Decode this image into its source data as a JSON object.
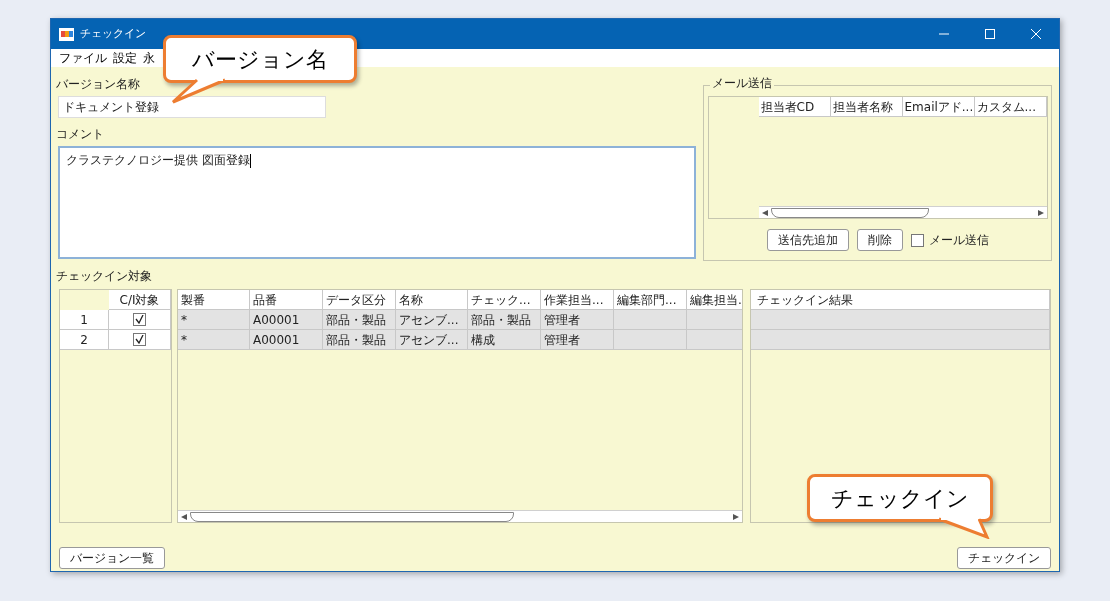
{
  "window": {
    "title": "チェックイン"
  },
  "menu": [
    "ファイル",
    "設定",
    "永"
  ],
  "version_name": {
    "label": "バージョン名称",
    "value": "ドキュメント登録"
  },
  "comment": {
    "label": "コメント",
    "value": "クラステクノロジー提供 図面登録"
  },
  "mail": {
    "legend": "メール送信",
    "columns": [
      "担当者CD",
      "担当者名称",
      "Emailアド...",
      "カスタム..."
    ],
    "buttons": [
      "送信先追加",
      "削除"
    ],
    "send_checkbox": {
      "label": "メール送信",
      "checked": false
    }
  },
  "targets": {
    "label": "チェックイン対象",
    "check_column": "C/I対象",
    "rows": [
      {
        "number": "1",
        "checked": true
      },
      {
        "number": "2",
        "checked": true
      }
    ]
  },
  "items": {
    "columns": [
      "製番",
      "品番",
      "データ区分",
      "名称",
      "チェック...",
      "作業担当...",
      "編集部門...",
      "編集担当."
    ],
    "rows": [
      [
        "*",
        "A00001",
        "部品・製品",
        "アセンブ...",
        "部品・製品",
        "管理者",
        "",
        ""
      ],
      [
        "*",
        "A00001",
        "部品・製品",
        "アセンブ...",
        "構成",
        "管理者",
        "",
        ""
      ]
    ]
  },
  "results": {
    "column": "チェックイン結果"
  },
  "footer_buttons": [
    "バージョン一覧",
    "チェックイン"
  ],
  "callouts": [
    {
      "text": "バージョン名",
      "kind": "version"
    },
    {
      "text": "チェックイン",
      "kind": "checkin"
    }
  ]
}
